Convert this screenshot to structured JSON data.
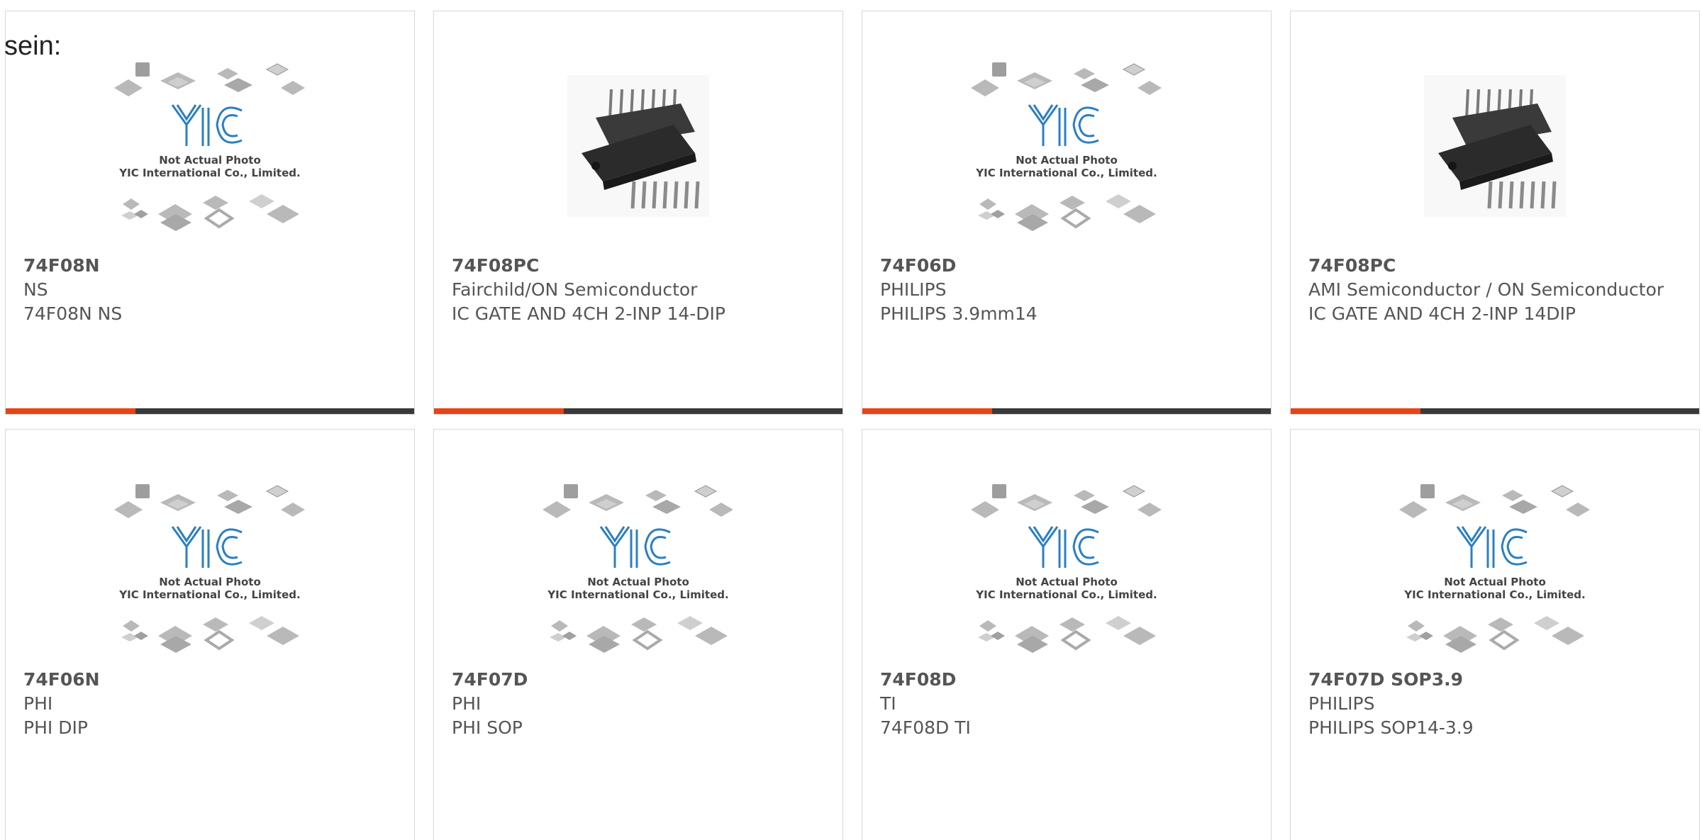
{
  "intro": "sein:",
  "placeholder": {
    "line1": "Not Actual Photo",
    "line2": "YIC International Co., Limited.",
    "logo": "YIC"
  },
  "products": [
    {
      "part": "74F08N",
      "maker": "NS",
      "desc": "74F08N NS",
      "image": "placeholder"
    },
    {
      "part": "74F08PC",
      "maker": "Fairchild/ON Semiconductor",
      "desc": "IC GATE AND 4CH 2-INP 14-DIP",
      "image": "dip-chip"
    },
    {
      "part": "74F06D",
      "maker": "PHILIPS",
      "desc": "PHILIPS 3.9mm14",
      "image": "placeholder"
    },
    {
      "part": "74F08PC",
      "maker": "AMI Semiconductor / ON Semiconductor",
      "desc": "IC GATE AND 4CH 2-INP 14DIP",
      "image": "dip-chip"
    },
    {
      "part": "74F06N",
      "maker": "PHI",
      "desc": "PHI DIP",
      "image": "placeholder"
    },
    {
      "part": "74F07D",
      "maker": "PHI",
      "desc": "PHI SOP",
      "image": "placeholder"
    },
    {
      "part": "74F08D",
      "maker": "TI",
      "desc": "74F08D TI",
      "image": "placeholder"
    },
    {
      "part": "74F07D SOP3.9",
      "maker": "PHILIPS",
      "desc": "PHILIPS SOP14-3.9",
      "image": "placeholder"
    }
  ],
  "colors": {
    "accent": "#e84315",
    "bar": "#3a3a3a",
    "logo": "#2b7fc1"
  }
}
